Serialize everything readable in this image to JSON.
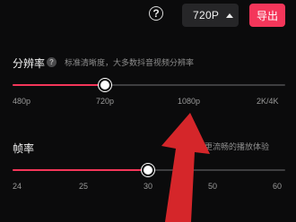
{
  "toolbar": {
    "help_glyph": "?",
    "resolution_value": "720P",
    "export_label": "导出"
  },
  "resolution": {
    "title": "分辨率",
    "hint": "标准清晰度，大多数抖音视频分辨率",
    "ticks": [
      "480p",
      "720p",
      "1080p",
      "2K/4K"
    ],
    "selected": "720p",
    "slider_value_fraction": 0.34
  },
  "framerate": {
    "title": "帧率",
    "hint": "给你更流畅的播放体验",
    "ticks": [
      "24",
      "25",
      "30",
      "50",
      "60"
    ],
    "selected": "30",
    "slider_value_fraction": 0.5
  },
  "colors": {
    "accent": "#f4365a",
    "arrow": "#d5262a",
    "background": "#0b0b0c"
  },
  "icons": {
    "help": "help-icon",
    "dropdown": "caret-up-icon",
    "info": "info-icon",
    "annotation": "red-arrow-annotation"
  }
}
